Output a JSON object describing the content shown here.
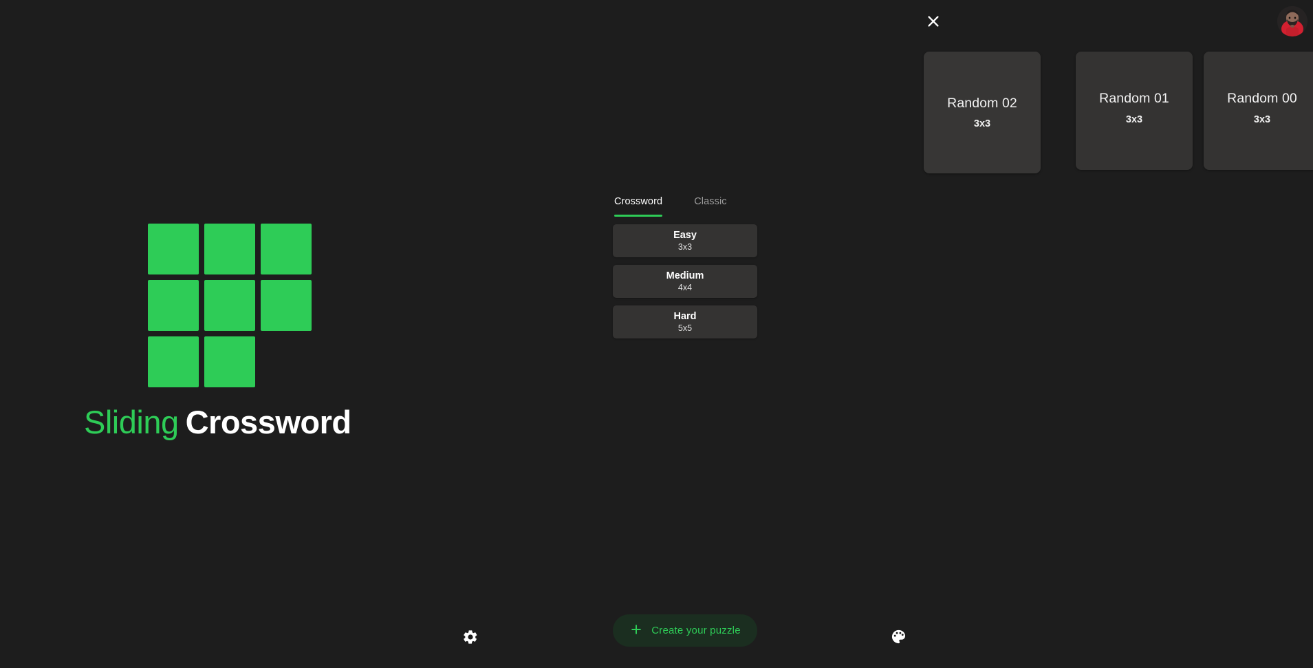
{
  "app": {
    "title": "Sliding Crossword",
    "brand_word_1": "Sliding",
    "brand_word_2": "Crossword",
    "background_color": "#1d1d1d",
    "accent_color": "#2ecc57",
    "surface_color": "#343332"
  },
  "header": {
    "close_label": "close-icon",
    "avatar_label": "user-avatar"
  },
  "logo": {
    "tiles": [
      "filled",
      "filled",
      "filled",
      "filled",
      "filled",
      "filled",
      "filled",
      "filled",
      "empty"
    ]
  },
  "recent": {
    "cards": [
      {
        "title": "Random 02",
        "size": "3x3"
      },
      {
        "title": "Random 01",
        "size": "3x3"
      },
      {
        "title": "Random 00",
        "size": "3x3"
      }
    ]
  },
  "mode_tabs": {
    "items": [
      {
        "label": "Crossword",
        "active": true
      },
      {
        "label": "Classic",
        "active": false
      }
    ]
  },
  "difficulty": {
    "options": [
      {
        "name": "Easy",
        "size": "3x3"
      },
      {
        "name": "Medium",
        "size": "4x4"
      },
      {
        "name": "Hard",
        "size": "5x5"
      }
    ]
  },
  "bottom_bar": {
    "settings_label": "gear-icon",
    "theme_label": "palette-icon",
    "create_label": "Create your puzzle"
  }
}
